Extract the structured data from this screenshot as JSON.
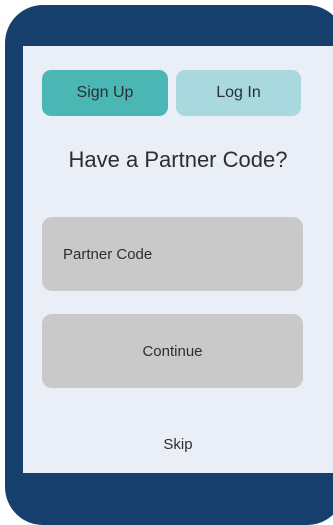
{
  "tabs": {
    "signup_label": "Sign Up",
    "login_label": "Log In"
  },
  "heading": "Have a Partner Code?",
  "partner_code": {
    "placeholder": "Partner Code",
    "value": ""
  },
  "continue_label": "Continue",
  "skip_label": "Skip",
  "colors": {
    "frame": "#173f6e",
    "screen": "#e9eef7",
    "signup_active": "#4bb7b5",
    "login_inactive": "#a9d8df",
    "field": "#c9c9c9"
  }
}
